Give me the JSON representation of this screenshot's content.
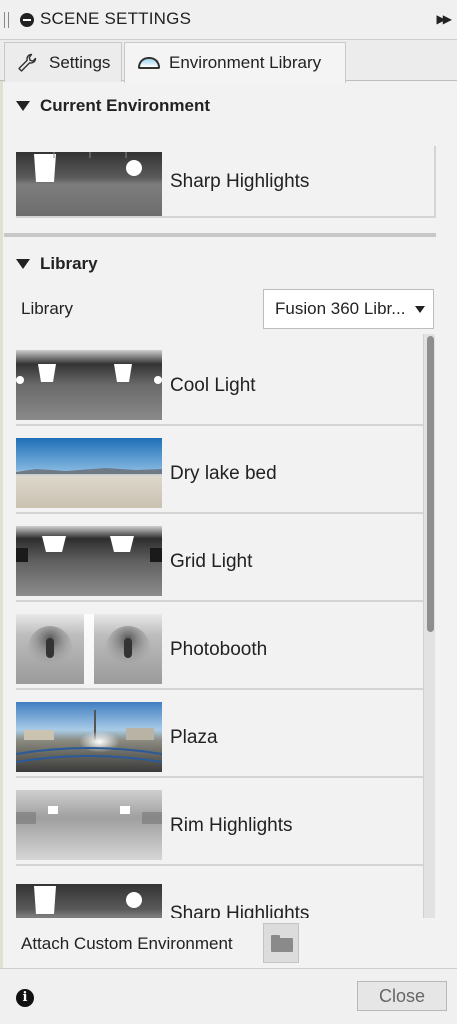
{
  "panel": {
    "title": "SCENE SETTINGS"
  },
  "tabs": [
    {
      "label": "Settings",
      "icon": "wrench-icon"
    },
    {
      "label": "Environment Library",
      "icon": "dome-icon",
      "active": true
    }
  ],
  "current_environment": {
    "heading": "Current Environment",
    "item": {
      "name": "Sharp Highlights",
      "thumbnail": "sharp-highlights"
    }
  },
  "library": {
    "heading": "Library",
    "label": "Library",
    "selected": "Fusion 360 Libr...",
    "items": [
      {
        "name": "Cool Light",
        "thumbnail": "cool-light"
      },
      {
        "name": "Dry lake bed",
        "thumbnail": "dry-lake-bed"
      },
      {
        "name": "Grid Light",
        "thumbnail": "grid-light"
      },
      {
        "name": "Photobooth",
        "thumbnail": "photobooth"
      },
      {
        "name": "Plaza",
        "thumbnail": "plaza"
      },
      {
        "name": "Rim Highlights",
        "thumbnail": "rim-highlights"
      },
      {
        "name": "Sharp Highlights",
        "thumbnail": "sharp-highlights"
      }
    ]
  },
  "attach": {
    "label": "Attach Custom Environment"
  },
  "footer": {
    "close_label": "Close"
  }
}
